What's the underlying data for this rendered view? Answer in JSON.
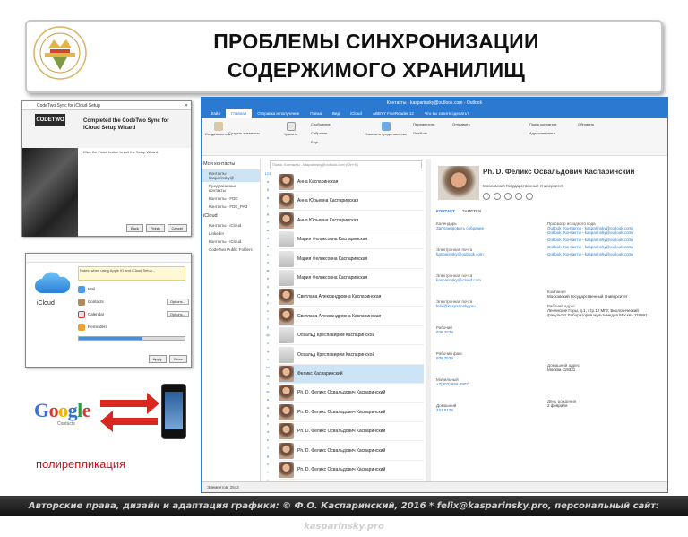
{
  "header": {
    "title_line1": "ПРОБЛЕМЫ СИНХРОНИЗАЦИИ",
    "title_line2": "СОДЕРЖИМОГО ХРАНИЛИЩ"
  },
  "codetwo": {
    "title": "CodeTwo Sync for iCloud Setup",
    "logo": "CODETWO",
    "heading": "Completed the CodeTwo Sync for iCloud Setup Wizard",
    "body": "Click the Finish button to exit the Setup Wizard.",
    "buttons": [
      "Back",
      "Finish",
      "Cancel"
    ]
  },
  "icloud": {
    "label": "iCloud",
    "note": "Notes, when using Apple ID and iCloud Setup...",
    "rows": [
      "Mail",
      "Contacts",
      "Calendar",
      "Reminders"
    ],
    "options_label": "Options...",
    "apply": "Apply",
    "close": "Close"
  },
  "google": {
    "letters": [
      "G",
      "o",
      "o",
      "g",
      "l",
      "e"
    ],
    "sub": "Contacts"
  },
  "polyreplication": "полирепликация",
  "outlook": {
    "titlebar": "Контакты - kasparinsky@outlook.com - Outlook",
    "tabs": [
      "Файл",
      "Главная",
      "Отправка и получение",
      "Папка",
      "Вид",
      "iCloud",
      "ABBYY FineReader 12",
      "Что вы хотите сделать?"
    ],
    "ribbon": [
      "Создать контакт",
      "Создать элементы",
      "Удалить",
      "Сообщение",
      "Собрание",
      "Еще",
      "Изменить представление",
      "Переместить",
      "OneNote",
      "Отправить",
      "Поиск контактов",
      "Адресная книга",
      "Обновить"
    ],
    "nav_group1": "Мои контакты",
    "nav_items1": [
      "Контакты - kasparinsky@",
      "Предлагаемые контакты",
      "Контакты - FDK",
      "Контакты - FDK_РАЗ"
    ],
    "nav_group2": "iCloud",
    "nav_items2": [
      "Контакты - iCloud",
      "LinkedIn",
      "Контакты - iCloud",
      "CodeTwo Public Folders"
    ],
    "search_placeholder": "Поиск: Контакты - kasparinsky@outlook.com (Ctrl+E)",
    "letters": [
      "123",
      "а",
      "б",
      "в",
      "г",
      "д",
      "е",
      "ж",
      "з",
      "и",
      "к",
      "л",
      "м",
      "н",
      "о",
      "п",
      "р",
      "с",
      "т",
      "у",
      "ф",
      "х",
      "ц",
      "ч",
      "ш",
      "щ",
      "э",
      "ю",
      "я",
      "a",
      "b",
      "c",
      "d",
      "e",
      "f",
      "g",
      "h",
      "i",
      "j"
    ],
    "contacts": [
      {
        "name": "Анна Каспаринская",
        "avatar": "photo"
      },
      {
        "name": "Анна Юрьевна Каспаринская",
        "avatar": "photo"
      },
      {
        "name": "Анна Юрьевна Каспаринская",
        "avatar": "photo"
      },
      {
        "name": "Мария Феликсовна Каспаринская",
        "avatar": "none"
      },
      {
        "name": "Мария Феликсовна Каспаринская",
        "avatar": "none"
      },
      {
        "name": "Мария Феликсовна Каспаринская",
        "avatar": "none"
      },
      {
        "name": "Светлана Александровна Каспаринская",
        "avatar": "photo"
      },
      {
        "name": "Светлана Александровна Каспаринская",
        "avatar": "photo"
      },
      {
        "name": "Освальд Креспавиром Каспаринской",
        "avatar": "none"
      },
      {
        "name": "Освальд Креспавиром Каспаринской",
        "avatar": "none"
      },
      {
        "name": "Феликс Каспаринский",
        "avatar": "photo",
        "selected": true
      },
      {
        "name": "Ph. D. Феликс Освальдович Каспаринский",
        "avatar": "photo"
      },
      {
        "name": "Ph. D. Феликс Освальдович Каспаринский",
        "avatar": "photo"
      },
      {
        "name": "Ph. D. Феликс Освальдович Каспаринский",
        "avatar": "photo"
      },
      {
        "name": "Ph. D. Феликс Освальдович Каспаринский",
        "avatar": "photo"
      },
      {
        "name": "Ph. D. Феликс Освальдович Каспаринский",
        "avatar": "photo"
      }
    ],
    "card": {
      "name": "Ph. D. Феликс Освальдович Каспаринский",
      "org": "Московский Государственный Университет",
      "section_contact": "КОНТАКТ",
      "section_notes": "ЗАМЕТКИ",
      "left_fields": [
        {
          "label": "Календарь",
          "value": "Запланировать собрание"
        },
        {
          "label": "Электронная почта",
          "value": "kasparinsky@outlook.com"
        },
        {
          "label": "Электронная почта",
          "value": "kasparinsky@icloud.com"
        },
        {
          "label": "Электронная почта",
          "value": "felix@kasparinsky.pro"
        },
        {
          "label": "Рабочий",
          "value": "939 2538"
        },
        {
          "label": "Рабочий факс",
          "value": "939 2539"
        },
        {
          "label": "Мобильный",
          "value": "+7(903) 656-8907"
        },
        {
          "label": "Домашний",
          "value": "331 9123"
        }
      ],
      "right_fields": [
        {
          "label": "Просмотр исходного кода",
          "value": "Outlook (Контакты - kasparinsky@outlook.com)"
        },
        {
          "label": "",
          "value": "Outlook (Контакты - kasparinsky@outlook.com)"
        },
        {
          "label": "",
          "value": "Outlook (Контакты - kasparinsky@outlook.com)"
        },
        {
          "label": "",
          "value": "Outlook (Контакты - kasparinsky@outlook.com)"
        },
        {
          "label": "",
          "value": "Outlook (Контакты - kasparinsky@outlook.com)"
        },
        {
          "label": "Компания",
          "value": "Московский Государственный Университет"
        },
        {
          "label": "Рабочий адрес",
          "value": "Ленинские Горы, д.1, стр.12 МГУ, Биологический факультет Лаборатория мультимедиа Москва 119991"
        },
        {
          "label": "Домашний адрес",
          "value": "Москва 119331"
        },
        {
          "label": "День рождения",
          "value": "2 февраля"
        }
      ]
    },
    "status": "Элементов: 2542"
  },
  "footer": "Авторские права, дизайн и адаптация графики: © Ф.О. Каспаринский, 2016 * felix@kasparinsky.pro, персональный сайт: kasparinsky.pro"
}
